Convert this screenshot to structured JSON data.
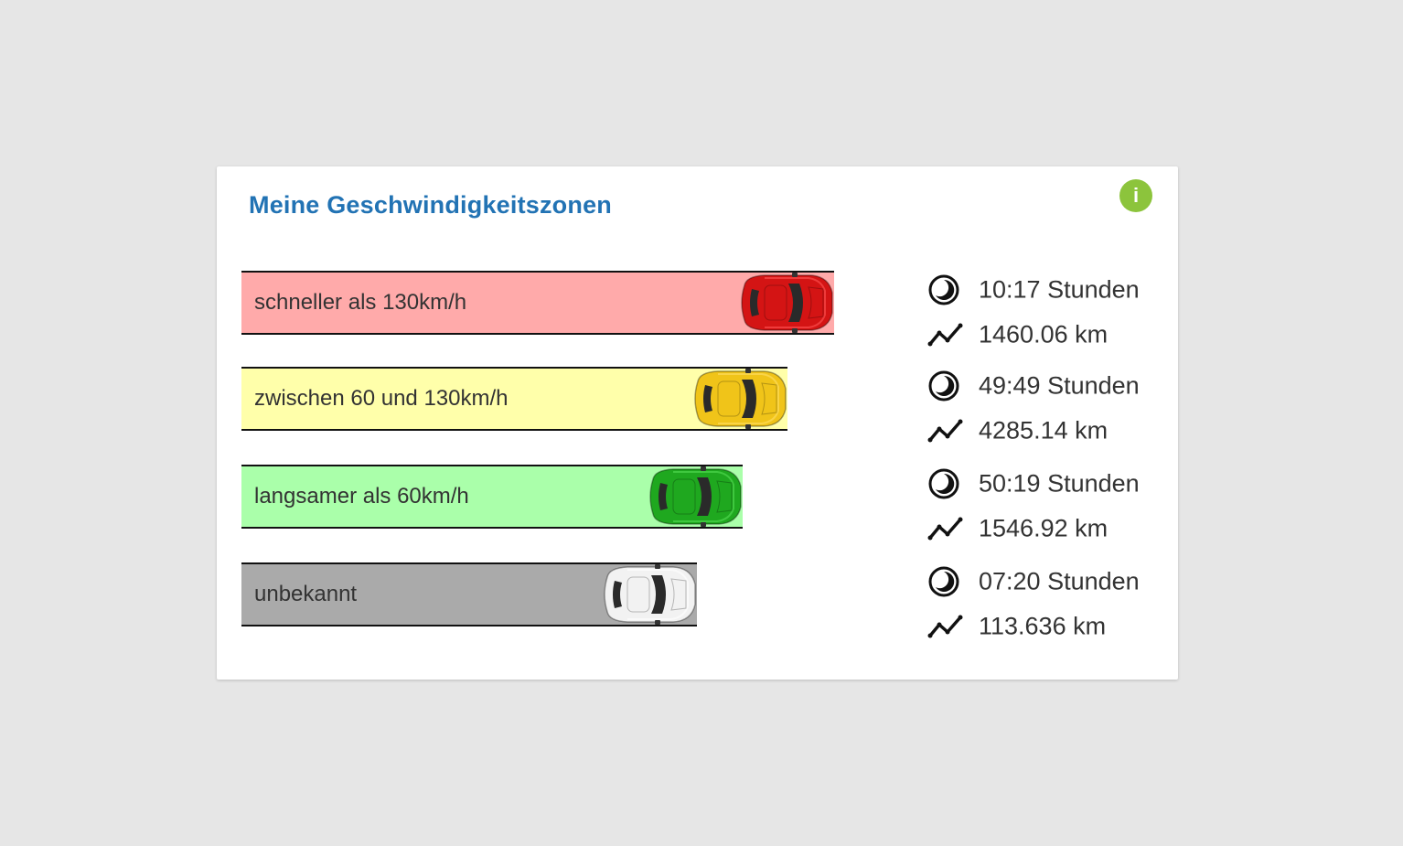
{
  "title": "Meine Geschwindigkeitszonen",
  "info_icon": "i",
  "zones": [
    {
      "label": "schneller als 130km/h",
      "bar_color": "#ffaaaa",
      "car_color": "#d41414",
      "car_highlight": "#ff5555",
      "time": "10:17 Stunden",
      "distance": "1460.06 km"
    },
    {
      "label": "zwischen 60 und 130km/h",
      "bar_color": "#ffffaa",
      "car_color": "#f0c419",
      "car_highlight": "#ffe066",
      "time": "49:49 Stunden",
      "distance": "4285.14 km"
    },
    {
      "label": "langsamer als 60km/h",
      "bar_color": "#aaffaa",
      "car_color": "#1fa81f",
      "car_highlight": "#55dd55",
      "time": "50:19 Stunden",
      "distance": "1546.92 km"
    },
    {
      "label": "unbekannt",
      "bar_color": "#aaaaaa",
      "car_color": "#f2f2f2",
      "car_highlight": "#ffffff",
      "time": "07:20 Stunden",
      "distance": "113.636 km"
    }
  ]
}
